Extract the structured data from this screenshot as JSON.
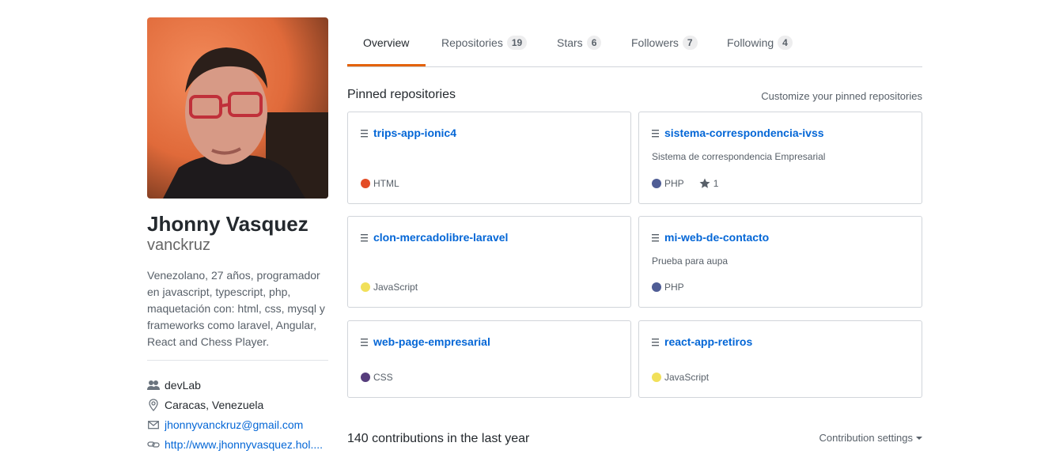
{
  "profile": {
    "full_name": "Jhonny Vasquez",
    "username": "vanckruz",
    "bio": "Venezolano, 27 años, programador en javascript, typescript, php, maquetación con: html, css, mysql y frameworks como laravel, Angular, React and Chess Player.",
    "details": [
      {
        "icon": "people-icon",
        "text": "devLab",
        "link": false
      },
      {
        "icon": "location-icon",
        "text": "Caracas, Venezuela",
        "link": false
      },
      {
        "icon": "mail-icon",
        "text": "jhonnyvanckruz@gmail.com",
        "link": true
      },
      {
        "icon": "link-icon",
        "text": "http://www.jhonnyvasquez.hol....",
        "link": true
      }
    ]
  },
  "tabs": [
    {
      "label": "Overview",
      "count": null,
      "selected": true
    },
    {
      "label": "Repositories",
      "count": "19",
      "selected": false
    },
    {
      "label": "Stars",
      "count": "6",
      "selected": false
    },
    {
      "label": "Followers",
      "count": "7",
      "selected": false
    },
    {
      "label": "Following",
      "count": "4",
      "selected": false
    }
  ],
  "pinned": {
    "title": "Pinned repositories",
    "customize_label": "Customize your pinned repositories",
    "repos": [
      {
        "name": "trips-app-ionic4",
        "description": "",
        "language": "HTML",
        "language_color": "#e34c26",
        "stars": ""
      },
      {
        "name": "sistema-correspondencia-ivss",
        "description": "Sistema de correspondencia Empresarial",
        "language": "PHP",
        "language_color": "#4F5D95",
        "stars": "1"
      },
      {
        "name": "clon-mercadolibre-laravel",
        "description": "",
        "language": "JavaScript",
        "language_color": "#f1e05a",
        "stars": ""
      },
      {
        "name": "mi-web-de-contacto",
        "description": "Prueba para aupa",
        "language": "PHP",
        "language_color": "#4F5D95",
        "stars": ""
      },
      {
        "name": "web-page-empresarial",
        "description": "",
        "language": "CSS",
        "language_color": "#563d7c",
        "stars": ""
      },
      {
        "name": "react-app-retiros",
        "description": "",
        "language": "JavaScript",
        "language_color": "#f1e05a",
        "stars": ""
      }
    ]
  },
  "contributions": {
    "title": "140 contributions in the last year",
    "settings_label": "Contribution settings"
  },
  "colors": {
    "accent": "#e36209",
    "link": "#0366d6",
    "muted": "#586069"
  }
}
